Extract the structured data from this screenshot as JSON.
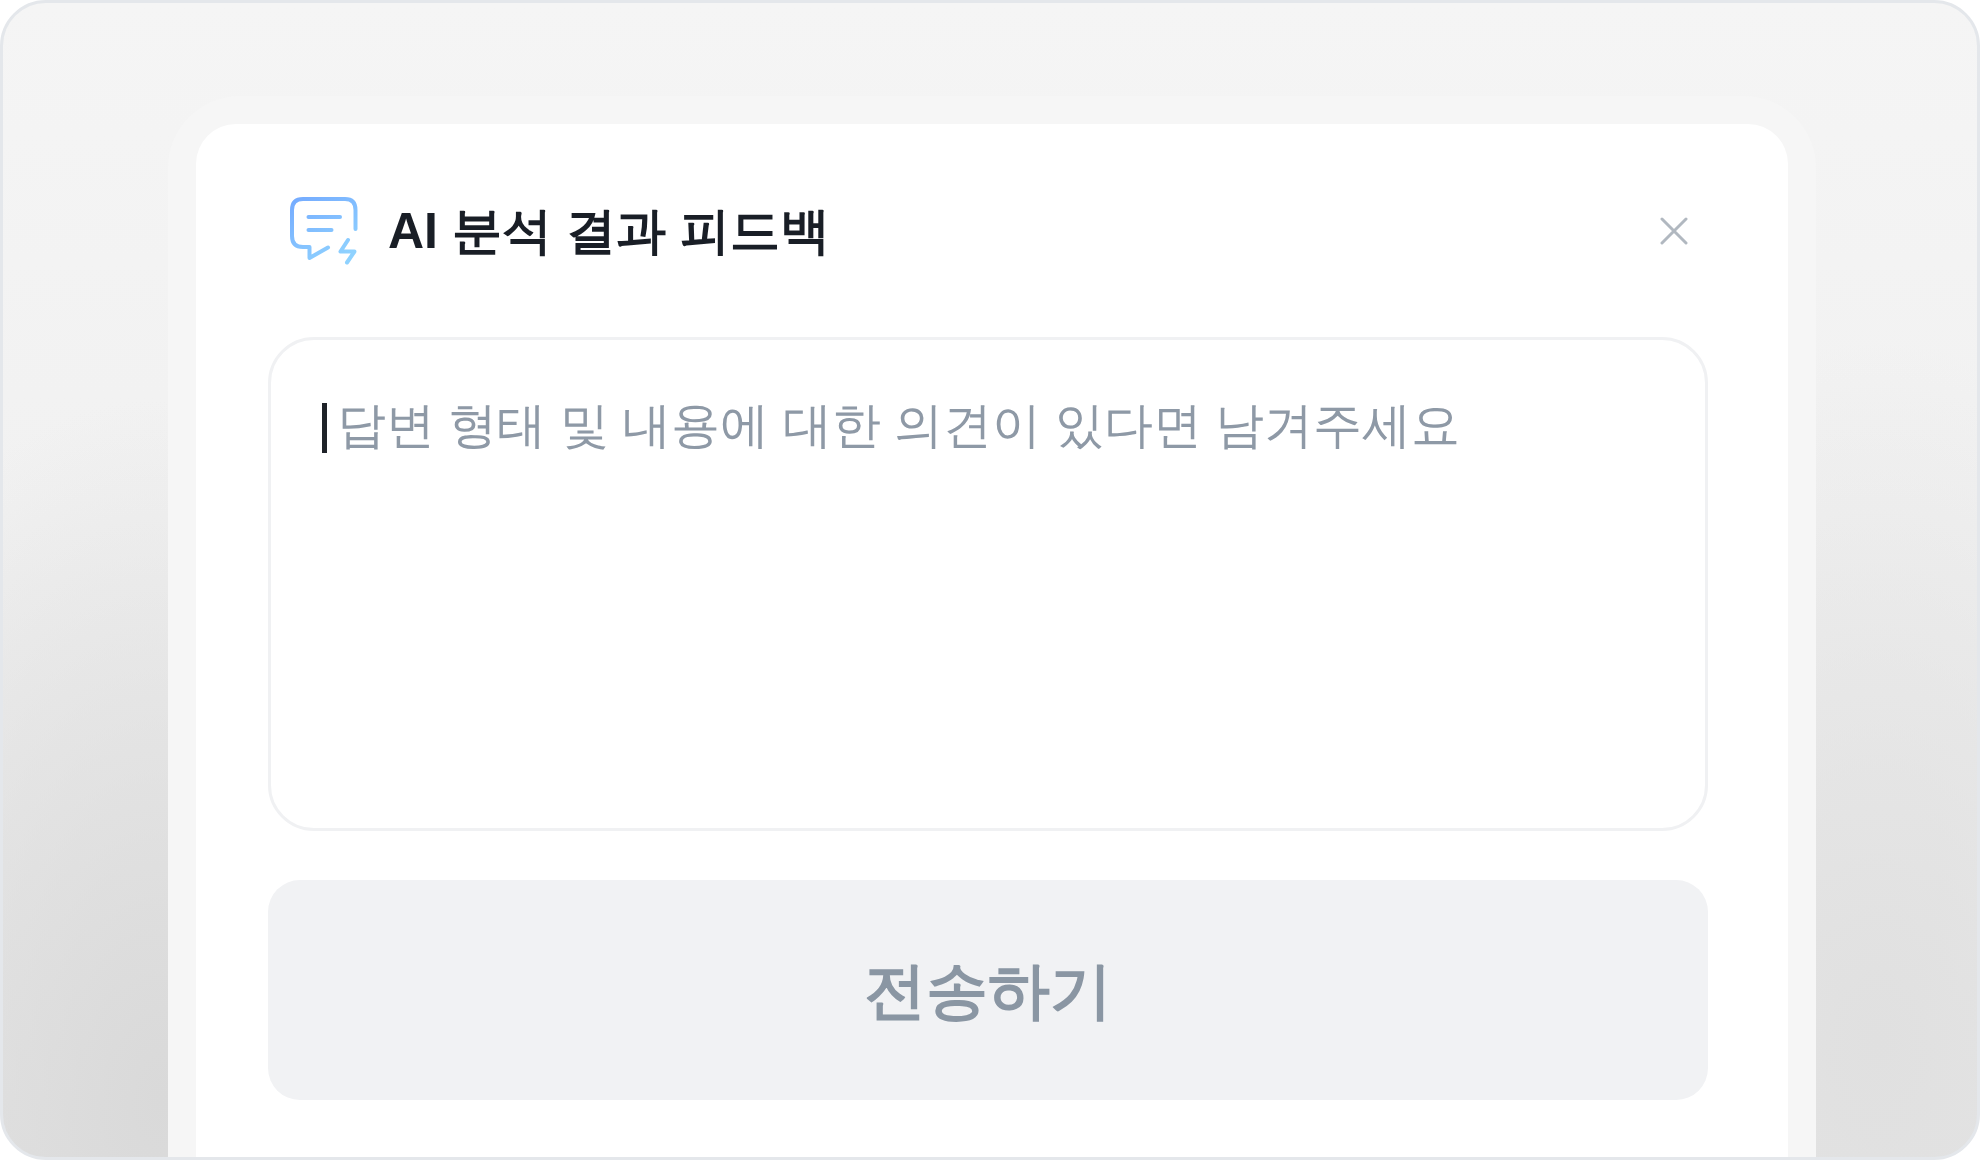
{
  "dialog": {
    "title": "AI 분석 결과 피드백"
  },
  "feedback_field": {
    "placeholder": "답변 형태 및 내용에 대한 의견이 있다면 남겨주세요",
    "focused": true
  },
  "submit_button": {
    "label": "전송하기",
    "disabled": true
  }
}
